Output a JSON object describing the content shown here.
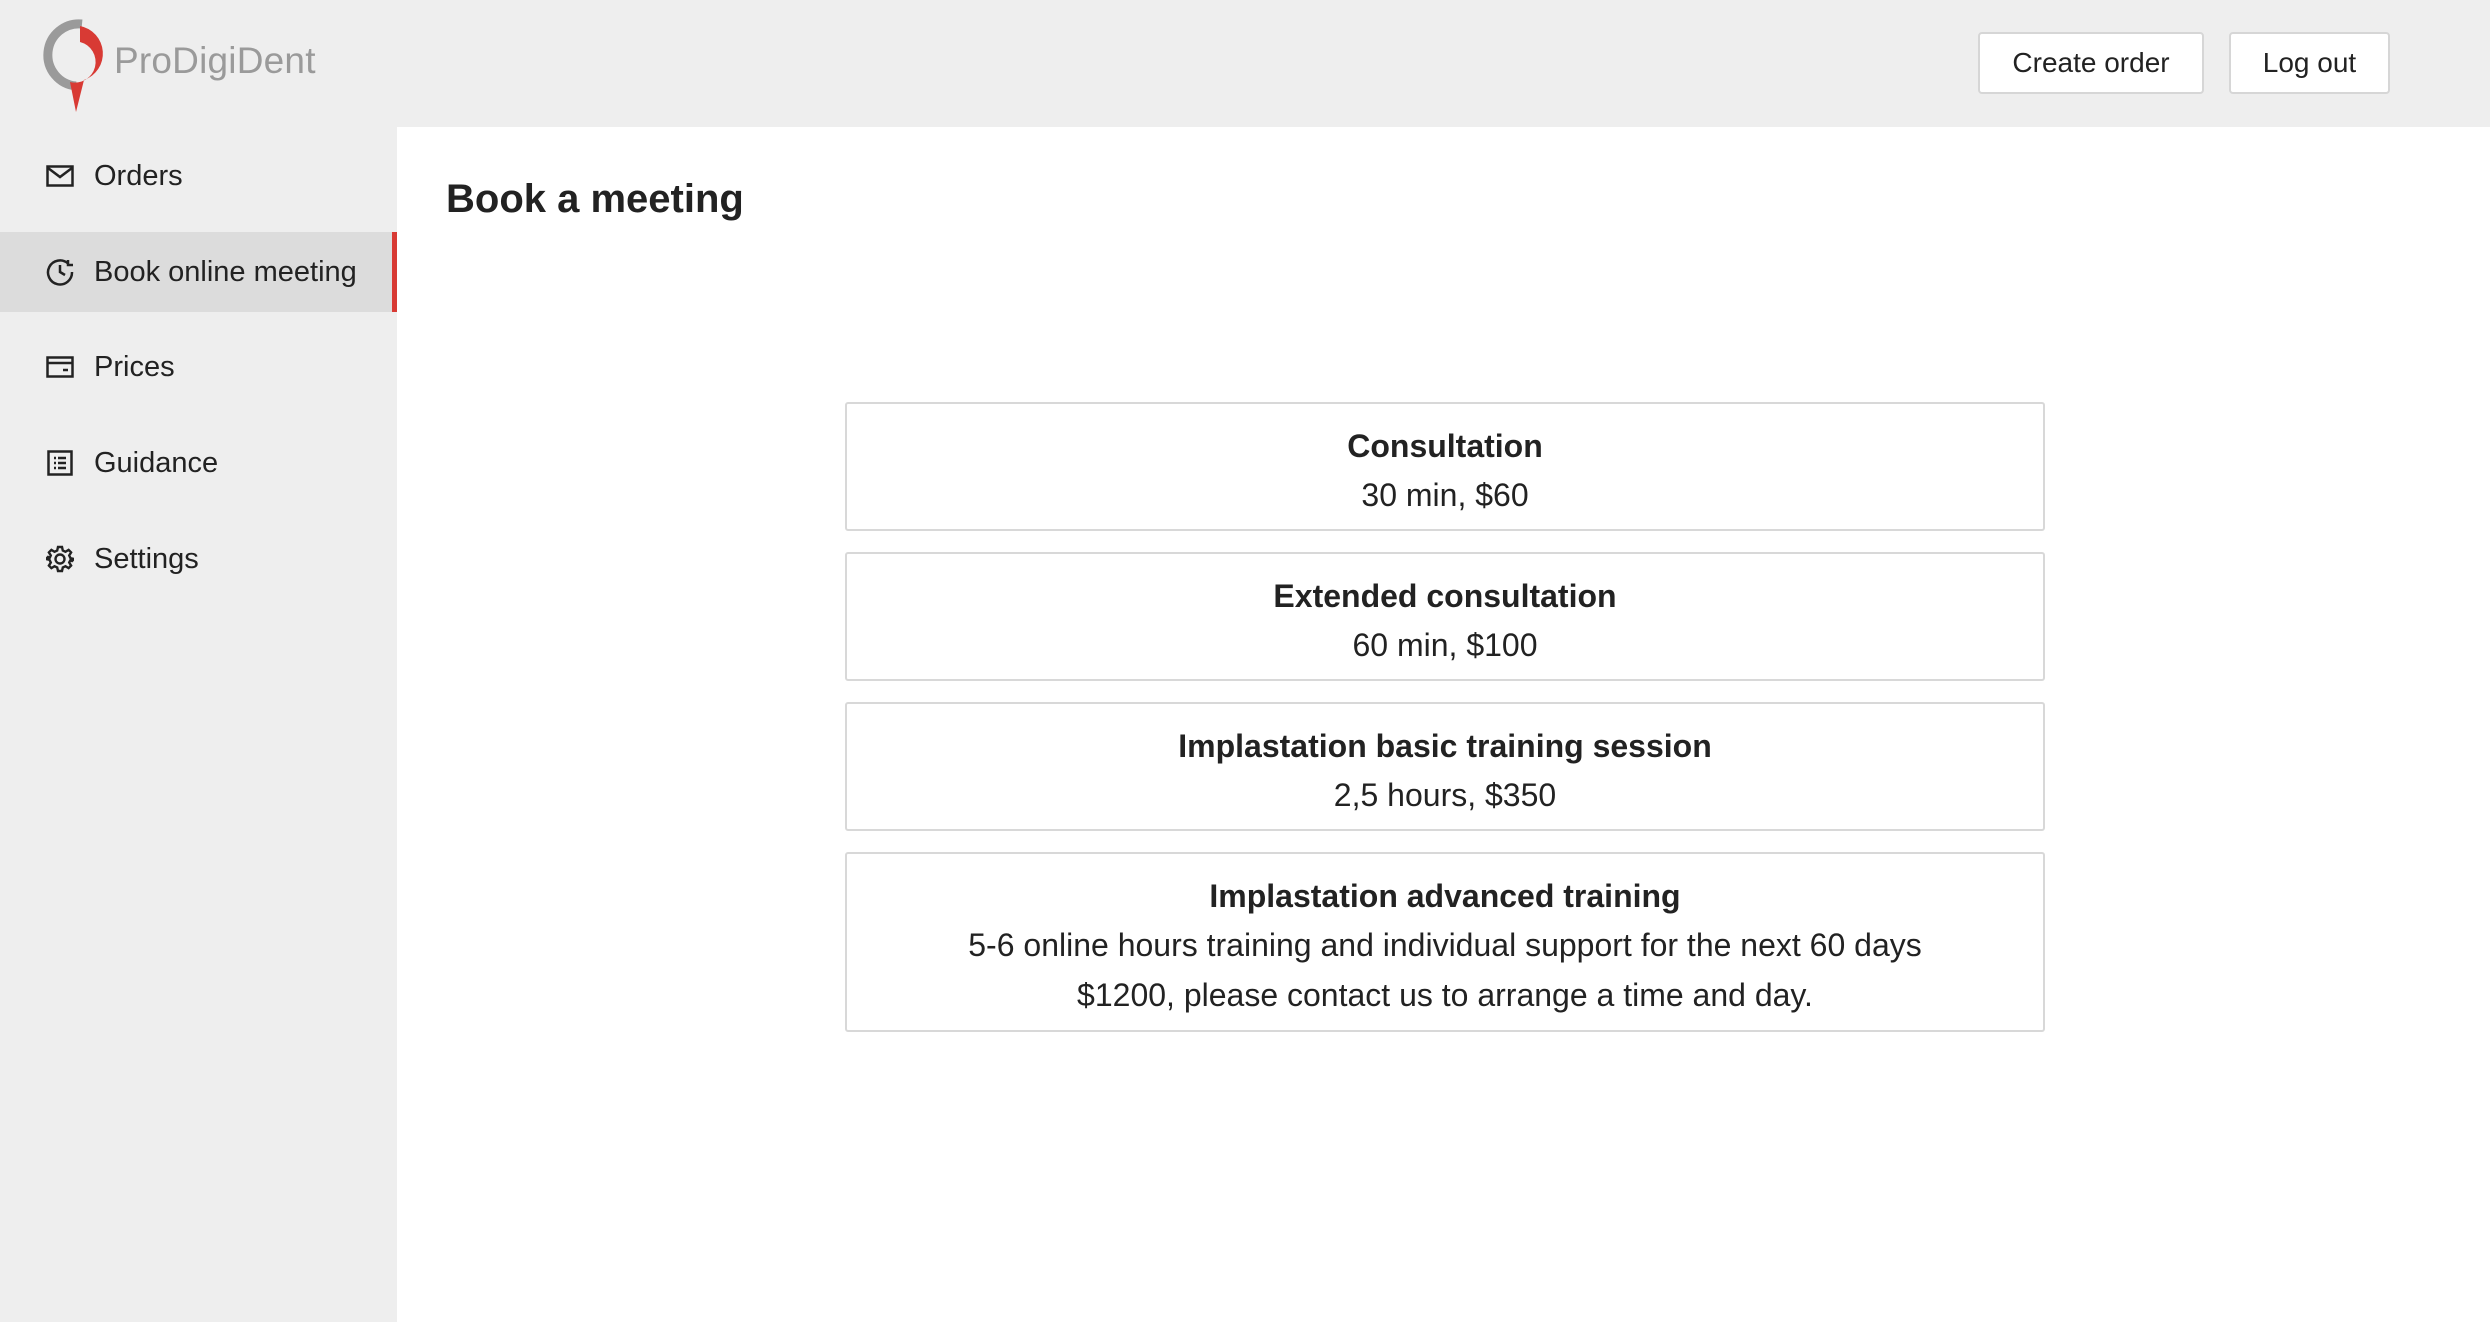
{
  "header": {
    "logo_text": "ProDigiDent",
    "create_order_label": "Create order",
    "logout_label": "Log out"
  },
  "sidebar": {
    "items": [
      {
        "label": "Orders",
        "icon": "mail-icon"
      },
      {
        "label": "Book online meeting",
        "icon": "clock-icon",
        "active": true
      },
      {
        "label": "Prices",
        "icon": "wallet-icon"
      },
      {
        "label": "Guidance",
        "icon": "list-icon"
      },
      {
        "label": "Settings",
        "icon": "gear-icon"
      }
    ]
  },
  "main": {
    "title": "Book a meeting",
    "cards": [
      {
        "title": "Consultation",
        "lines": [
          "30 min, $60"
        ]
      },
      {
        "title": "Extended consultation",
        "lines": [
          "60 min, $100"
        ]
      },
      {
        "title": "Implastation basic training session",
        "lines": [
          "2,5 hours, $350"
        ]
      },
      {
        "title": "Implastation advanced training",
        "lines": [
          "5-6 online hours training and individual support for the next 60 days",
          "$1200, please contact us to arrange a time and day."
        ]
      }
    ]
  },
  "colors": {
    "accent": "#d83a34",
    "header_bg": "#eeeeee",
    "sidebar_active_bg": "#dcdcdc",
    "logo_text": "#9a9a9a"
  }
}
